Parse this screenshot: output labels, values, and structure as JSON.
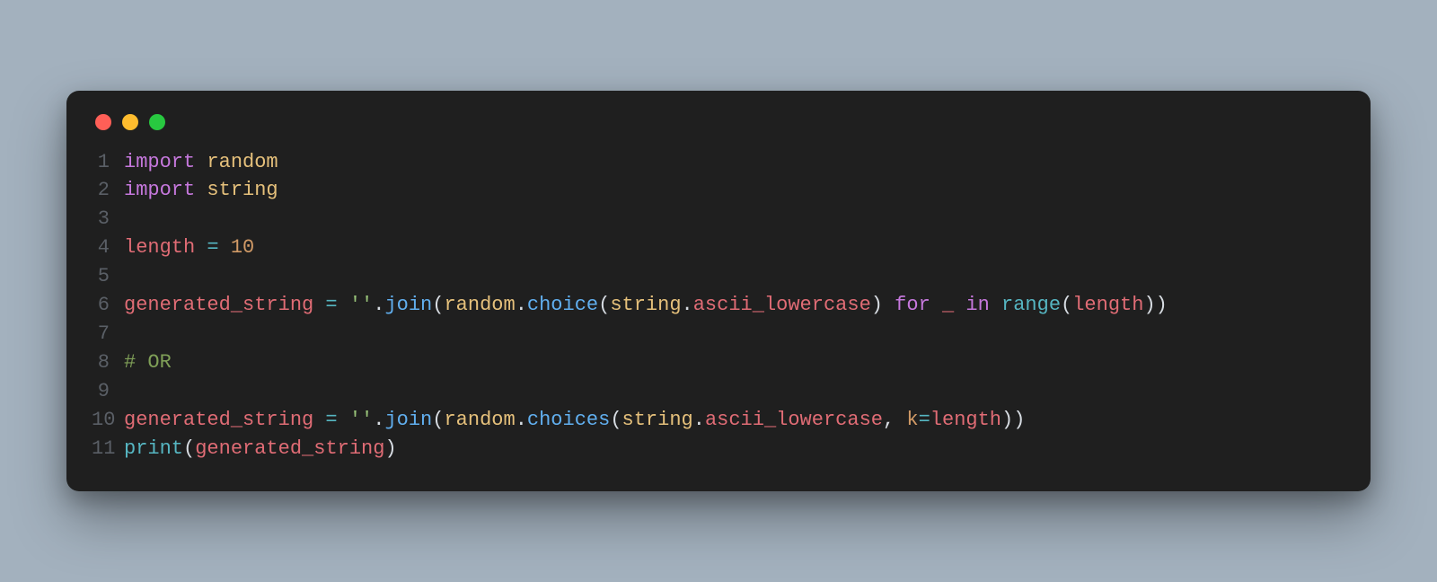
{
  "window": {
    "traffic_lights": [
      "red",
      "yellow",
      "green"
    ]
  },
  "colors": {
    "bg_page": "#a3b1be",
    "bg_window": "#1f1f1f",
    "gutter": "#5a5f66",
    "keyword": "#c678dd",
    "module": "#e5c07b",
    "ident": "#e06c75",
    "op": "#56b6c2",
    "number": "#d19a66",
    "string": "#98c379",
    "call": "#61afef",
    "builtin": "#56b6c2",
    "comment": "#7f9f57",
    "default": "#d8dde3"
  },
  "code": {
    "language": "python",
    "lines": [
      {
        "n": "1",
        "tokens": [
          {
            "t": "import ",
            "c": "keyword"
          },
          {
            "t": "random",
            "c": "module"
          }
        ]
      },
      {
        "n": "2",
        "tokens": [
          {
            "t": "import ",
            "c": "keyword"
          },
          {
            "t": "string",
            "c": "module"
          }
        ]
      },
      {
        "n": "3",
        "tokens": [
          {
            "t": "",
            "c": "default"
          }
        ]
      },
      {
        "n": "4",
        "tokens": [
          {
            "t": "length",
            "c": "ident"
          },
          {
            "t": " = ",
            "c": "op"
          },
          {
            "t": "10",
            "c": "number"
          }
        ]
      },
      {
        "n": "5",
        "tokens": [
          {
            "t": "",
            "c": "default"
          }
        ]
      },
      {
        "n": "6",
        "tokens": [
          {
            "t": "generated_string",
            "c": "ident"
          },
          {
            "t": " = ",
            "c": "op"
          },
          {
            "t": "''",
            "c": "string"
          },
          {
            "t": ".",
            "c": "punct"
          },
          {
            "t": "join",
            "c": "call"
          },
          {
            "t": "(",
            "c": "punct"
          },
          {
            "t": "random",
            "c": "module"
          },
          {
            "t": ".",
            "c": "punct"
          },
          {
            "t": "choice",
            "c": "call"
          },
          {
            "t": "(",
            "c": "punct"
          },
          {
            "t": "string",
            "c": "module"
          },
          {
            "t": ".",
            "c": "punct"
          },
          {
            "t": "ascii_lowercase",
            "c": "attr"
          },
          {
            "t": ")",
            "c": "punct"
          },
          {
            "t": " for ",
            "c": "keyword"
          },
          {
            "t": "_",
            "c": "ident"
          },
          {
            "t": " in ",
            "c": "keyword"
          },
          {
            "t": "range",
            "c": "builtin"
          },
          {
            "t": "(",
            "c": "punct"
          },
          {
            "t": "length",
            "c": "ident"
          },
          {
            "t": ")",
            "c": "punct"
          },
          {
            "t": ")",
            "c": "punct"
          }
        ]
      },
      {
        "n": "7",
        "tokens": [
          {
            "t": "",
            "c": "default"
          }
        ]
      },
      {
        "n": "8",
        "tokens": [
          {
            "t": "# OR",
            "c": "comment"
          }
        ]
      },
      {
        "n": "9",
        "tokens": [
          {
            "t": "",
            "c": "default"
          }
        ]
      },
      {
        "n": "10",
        "tokens": [
          {
            "t": "generated_string",
            "c": "ident"
          },
          {
            "t": " = ",
            "c": "op"
          },
          {
            "t": "''",
            "c": "string"
          },
          {
            "t": ".",
            "c": "punct"
          },
          {
            "t": "join",
            "c": "call"
          },
          {
            "t": "(",
            "c": "punct"
          },
          {
            "t": "random",
            "c": "module"
          },
          {
            "t": ".",
            "c": "punct"
          },
          {
            "t": "choices",
            "c": "call"
          },
          {
            "t": "(",
            "c": "punct"
          },
          {
            "t": "string",
            "c": "module"
          },
          {
            "t": ".",
            "c": "punct"
          },
          {
            "t": "ascii_lowercase",
            "c": "attr"
          },
          {
            "t": ", ",
            "c": "punct"
          },
          {
            "t": "k",
            "c": "param"
          },
          {
            "t": "=",
            "c": "op"
          },
          {
            "t": "length",
            "c": "ident"
          },
          {
            "t": ")",
            "c": "punct"
          },
          {
            "t": ")",
            "c": "punct"
          }
        ]
      },
      {
        "n": "11",
        "tokens": [
          {
            "t": "print",
            "c": "builtin"
          },
          {
            "t": "(",
            "c": "punct"
          },
          {
            "t": "generated_string",
            "c": "ident"
          },
          {
            "t": ")",
            "c": "punct"
          }
        ]
      }
    ]
  }
}
